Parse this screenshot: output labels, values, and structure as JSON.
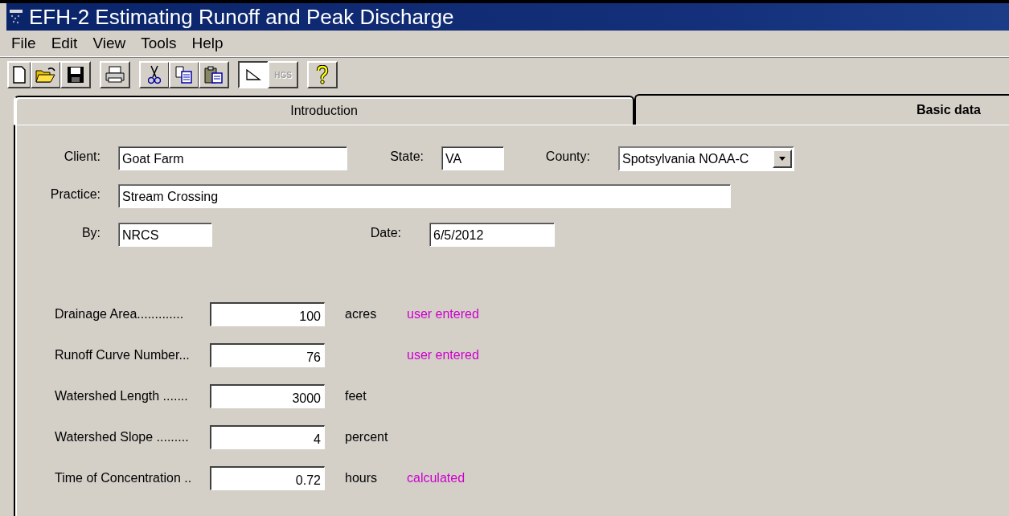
{
  "window": {
    "title": "EFH-2  Estimating Runoff and Peak Discharge"
  },
  "menu": [
    "File",
    "Edit",
    "View",
    "Tools",
    "Help"
  ],
  "toolbar": [
    [
      {
        "kind": "new",
        "pressed": false
      },
      {
        "kind": "open",
        "pressed": false
      },
      {
        "kind": "save",
        "pressed": false
      }
    ],
    [
      {
        "kind": "print",
        "pressed": false
      }
    ],
    [
      {
        "kind": "cut",
        "pressed": false
      },
      {
        "kind": "copy",
        "pressed": false
      },
      {
        "kind": "paste",
        "pressed": false
      }
    ],
    [
      {
        "kind": "triangle",
        "pressed": true
      },
      {
        "kind": "text",
        "label": "HGS",
        "pressed": false,
        "disabled": true
      }
    ],
    [
      {
        "kind": "help",
        "pressed": false
      }
    ]
  ],
  "tabs": [
    {
      "label": "Introduction",
      "selected": false
    },
    {
      "label": "Basic data",
      "selected": true
    }
  ],
  "client": {
    "label": "Client:",
    "value": "Goat Farm"
  },
  "state": {
    "label": "State:",
    "value": "VA"
  },
  "county": {
    "label": "County:",
    "value": "Spotsylvania NOAA-C"
  },
  "practice": {
    "label": "Practice:",
    "value": "Stream Crossing"
  },
  "by": {
    "label": "By:",
    "value": "NRCS"
  },
  "date": {
    "label": "Date:",
    "value": "6/5/2012"
  },
  "rows": [
    {
      "label": "Drainage Area.............",
      "value": "100",
      "unit": "acres",
      "note": "user entered",
      "color": "#cc00cc"
    },
    {
      "label": "Runoff Curve Number...",
      "value": "76",
      "note": "user entered",
      "color": "#cc00cc"
    },
    {
      "label": "Watershed Length .......",
      "value": "3000",
      "unit": "feet"
    },
    {
      "label": "Watershed Slope .........",
      "value": "4",
      "unit": "percent"
    },
    {
      "label": "Time of Concentration ..",
      "value": "0.72",
      "unit": "hours",
      "note": "calculated",
      "color": "#cc00cc"
    }
  ]
}
